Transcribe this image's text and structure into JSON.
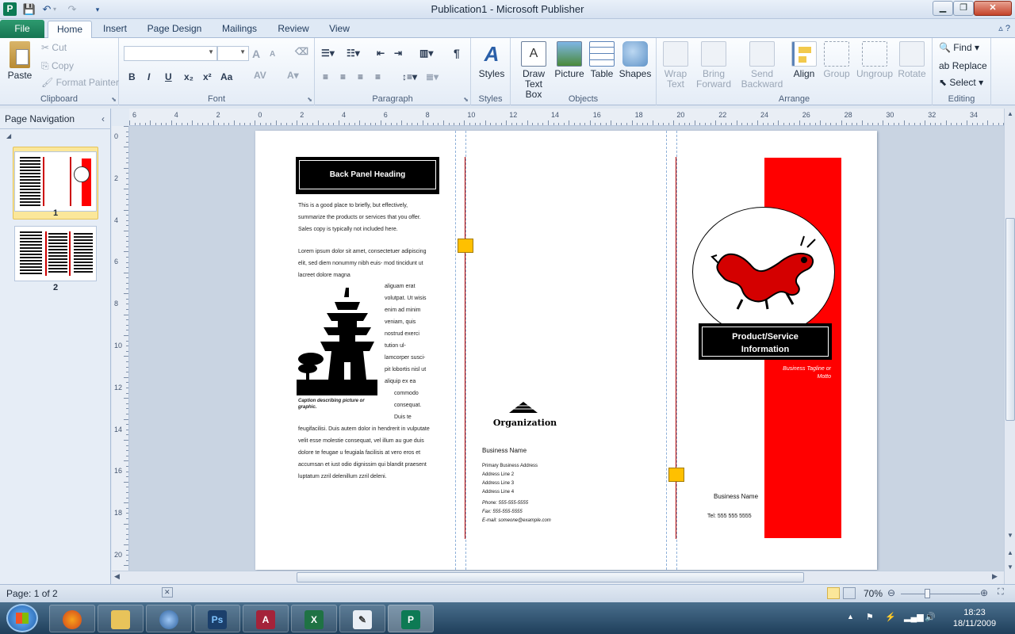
{
  "window": {
    "app_letter": "P",
    "title": "Publication1  -  Microsoft Publisher"
  },
  "tabs": {
    "file": "File",
    "items": [
      "Home",
      "Insert",
      "Page Design",
      "Mailings",
      "Review",
      "View"
    ]
  },
  "ribbon": {
    "clipboard": {
      "label": "Clipboard",
      "paste": "Paste",
      "cut": "Cut",
      "copy": "Copy",
      "format_painter": "Format Painter"
    },
    "font": {
      "label": "Font",
      "bold": "B",
      "italic": "I",
      "underline": "U",
      "subscript": "x₂",
      "superscript": "x²",
      "case": "Aa",
      "grow": "A",
      "shrink": "A"
    },
    "paragraph": {
      "label": "Paragraph",
      "pilcrow": "¶"
    },
    "styles": {
      "label": "Styles",
      "styles_btn": "Styles"
    },
    "objects": {
      "label": "Objects",
      "draw_text_box_1": "Draw",
      "draw_text_box_2": "Text Box",
      "picture": "Picture",
      "table": "Table",
      "shapes": "Shapes"
    },
    "arrange": {
      "label": "Arrange",
      "wrap_text_1": "Wrap",
      "wrap_text_2": "Text",
      "bring_forward_1": "Bring",
      "bring_forward_2": "Forward",
      "send_backward_1": "Send",
      "send_backward_2": "Backward",
      "align": "Align",
      "group": "Group",
      "ungroup": "Ungroup",
      "rotate": "Rotate"
    },
    "editing": {
      "label": "Editing",
      "find": "Find",
      "replace": "Replace",
      "select": "Select"
    }
  },
  "nav": {
    "title": "Page Navigation",
    "pages": [
      "1",
      "2"
    ]
  },
  "ruler": {
    "h": [
      "6",
      "4",
      "2",
      "0",
      "2",
      "4",
      "6",
      "8",
      "10",
      "12",
      "14",
      "16",
      "18",
      "20",
      "22",
      "24",
      "26",
      "28",
      "30",
      "32",
      "34"
    ],
    "v": [
      "0",
      "2",
      "4",
      "6",
      "8",
      "10",
      "12",
      "14",
      "16",
      "18",
      "20"
    ]
  },
  "publication": {
    "back_heading": "Back Panel Heading",
    "intro": "This is a good place to briefly, but effectively, summarize the products or services that you offer. Sales copy is typically not included here.",
    "lorem_top": "Lorem ipsum dolor sit amet, consectetuer adipiscing elit, sed diem nonummy nibh euis- mod tincidunt ut lacreet dolore magna",
    "lorem_wrap": [
      "aliguam erat",
      "volutpat. Ut wisis",
      "enim ad minim",
      "veniam, quis",
      "nostrud exerci",
      "tution ul-",
      "lamcorper susci-",
      "pit lobortis nisl ut",
      "aliquip ex ea",
      "commodo",
      "consequat.",
      "Duis te"
    ],
    "lorem_bottom": "feugifacilisi. Duis autem dolor in hendrerit in vulputate velit esse molestie consequat, vel illum au gue duis dolore te feugae u feugiala facilisis at vero eros et accumsan et iust odio dignissim qui blandit praesent luptatum zzril delenillum zzril deleni.",
    "caption": "Caption describing picture or graphic.",
    "org": "Organization",
    "business_name": "Business Name",
    "address": [
      "Primary Business Address",
      "Address Line 2",
      "Address Line 3",
      "Address Line 4"
    ],
    "phone": "Phone: 555-555-5555",
    "fax": "Fax: 555-555-5555",
    "email": "E-mail: someone@example.com",
    "product_heading_1": "Product/Service",
    "product_heading_2": "Information",
    "tagline_1": "Business Tagline or",
    "tagline_2": "Motto",
    "front_business_name": "Business Name",
    "front_tel": "Tel: 555 555 5555"
  },
  "status": {
    "page": "Page: 1 of 2",
    "zoom": "70%"
  },
  "taskbar": {
    "time": "18:23",
    "date": "18/11/2009"
  },
  "colors": {
    "accent_red": "#ff0000",
    "file_tab": "#1f8a60",
    "page_bg": "#ffffff"
  }
}
